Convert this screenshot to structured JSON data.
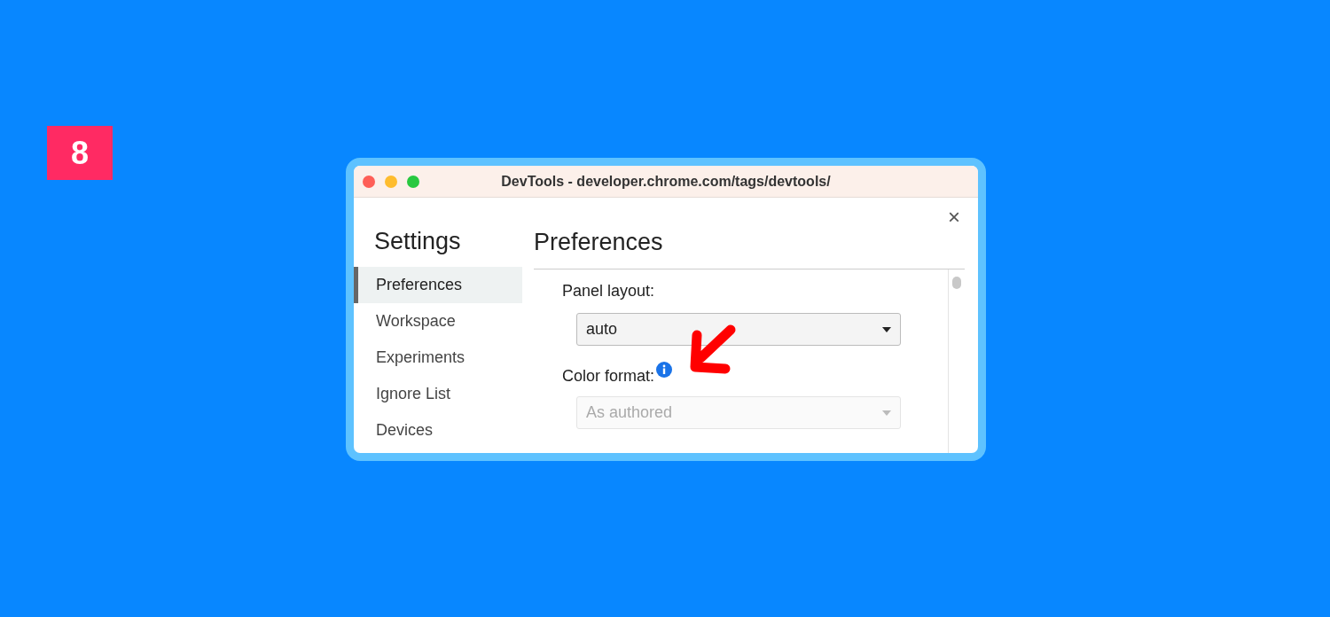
{
  "badge": "8",
  "window": {
    "title": "DevTools - developer.chrome.com/tags/devtools/",
    "close": "×"
  },
  "sidebar": {
    "heading": "Settings",
    "items": [
      {
        "label": "Preferences",
        "selected": true
      },
      {
        "label": "Workspace",
        "selected": false
      },
      {
        "label": "Experiments",
        "selected": false
      },
      {
        "label": "Ignore List",
        "selected": false
      },
      {
        "label": "Devices",
        "selected": false
      }
    ]
  },
  "main": {
    "heading": "Preferences",
    "fields": [
      {
        "label": "Panel layout:",
        "value": "auto",
        "disabled": false
      },
      {
        "label": "Color format:",
        "value": "As authored",
        "disabled": true,
        "info": true
      }
    ]
  }
}
